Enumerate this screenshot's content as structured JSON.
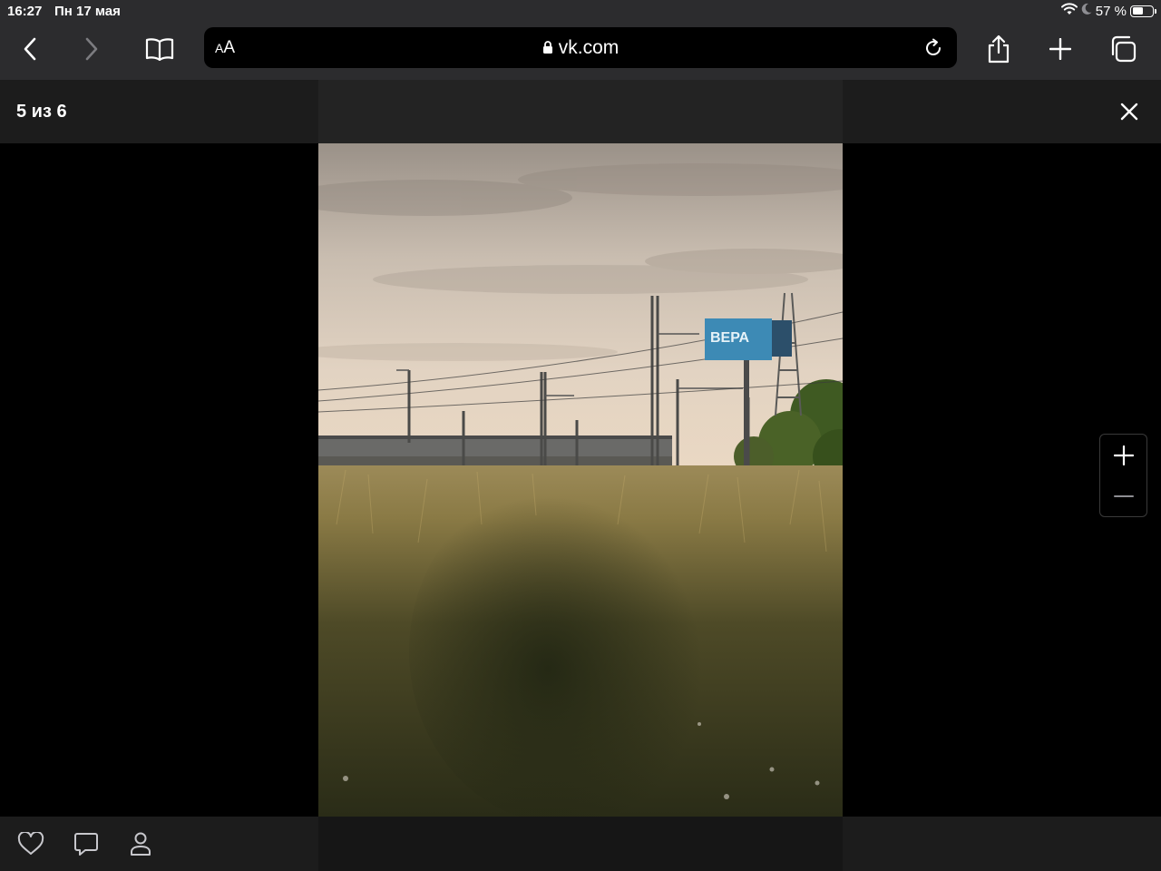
{
  "status_bar": {
    "time": "16:27",
    "date": "Пн 17 мая",
    "battery_text": "57 %",
    "battery_level": 0.57,
    "icons": [
      "wifi-icon",
      "moon-icon",
      "battery-icon"
    ]
  },
  "browser": {
    "text_size_label_small": "A",
    "text_size_label_large": "A",
    "url": "vk.com",
    "icons": [
      "back-icon",
      "forward-icon",
      "bookmarks-icon",
      "lock-icon",
      "reload-icon",
      "share-icon",
      "new-tab-icon",
      "tabs-icon"
    ]
  },
  "viewer": {
    "counter": "5 из 6",
    "photo": {
      "billboard_text": "ВЕРА"
    },
    "zoom_icons": [
      "zoom-in-icon",
      "zoom-out-icon"
    ],
    "footer_icons": [
      "like-icon",
      "comment-icon",
      "tag-person-icon"
    ]
  },
  "colors": {
    "toolbar_bg": "#2c2c2e",
    "viewer_bg": "#000000",
    "panel_bg": "#1c1c1c"
  }
}
